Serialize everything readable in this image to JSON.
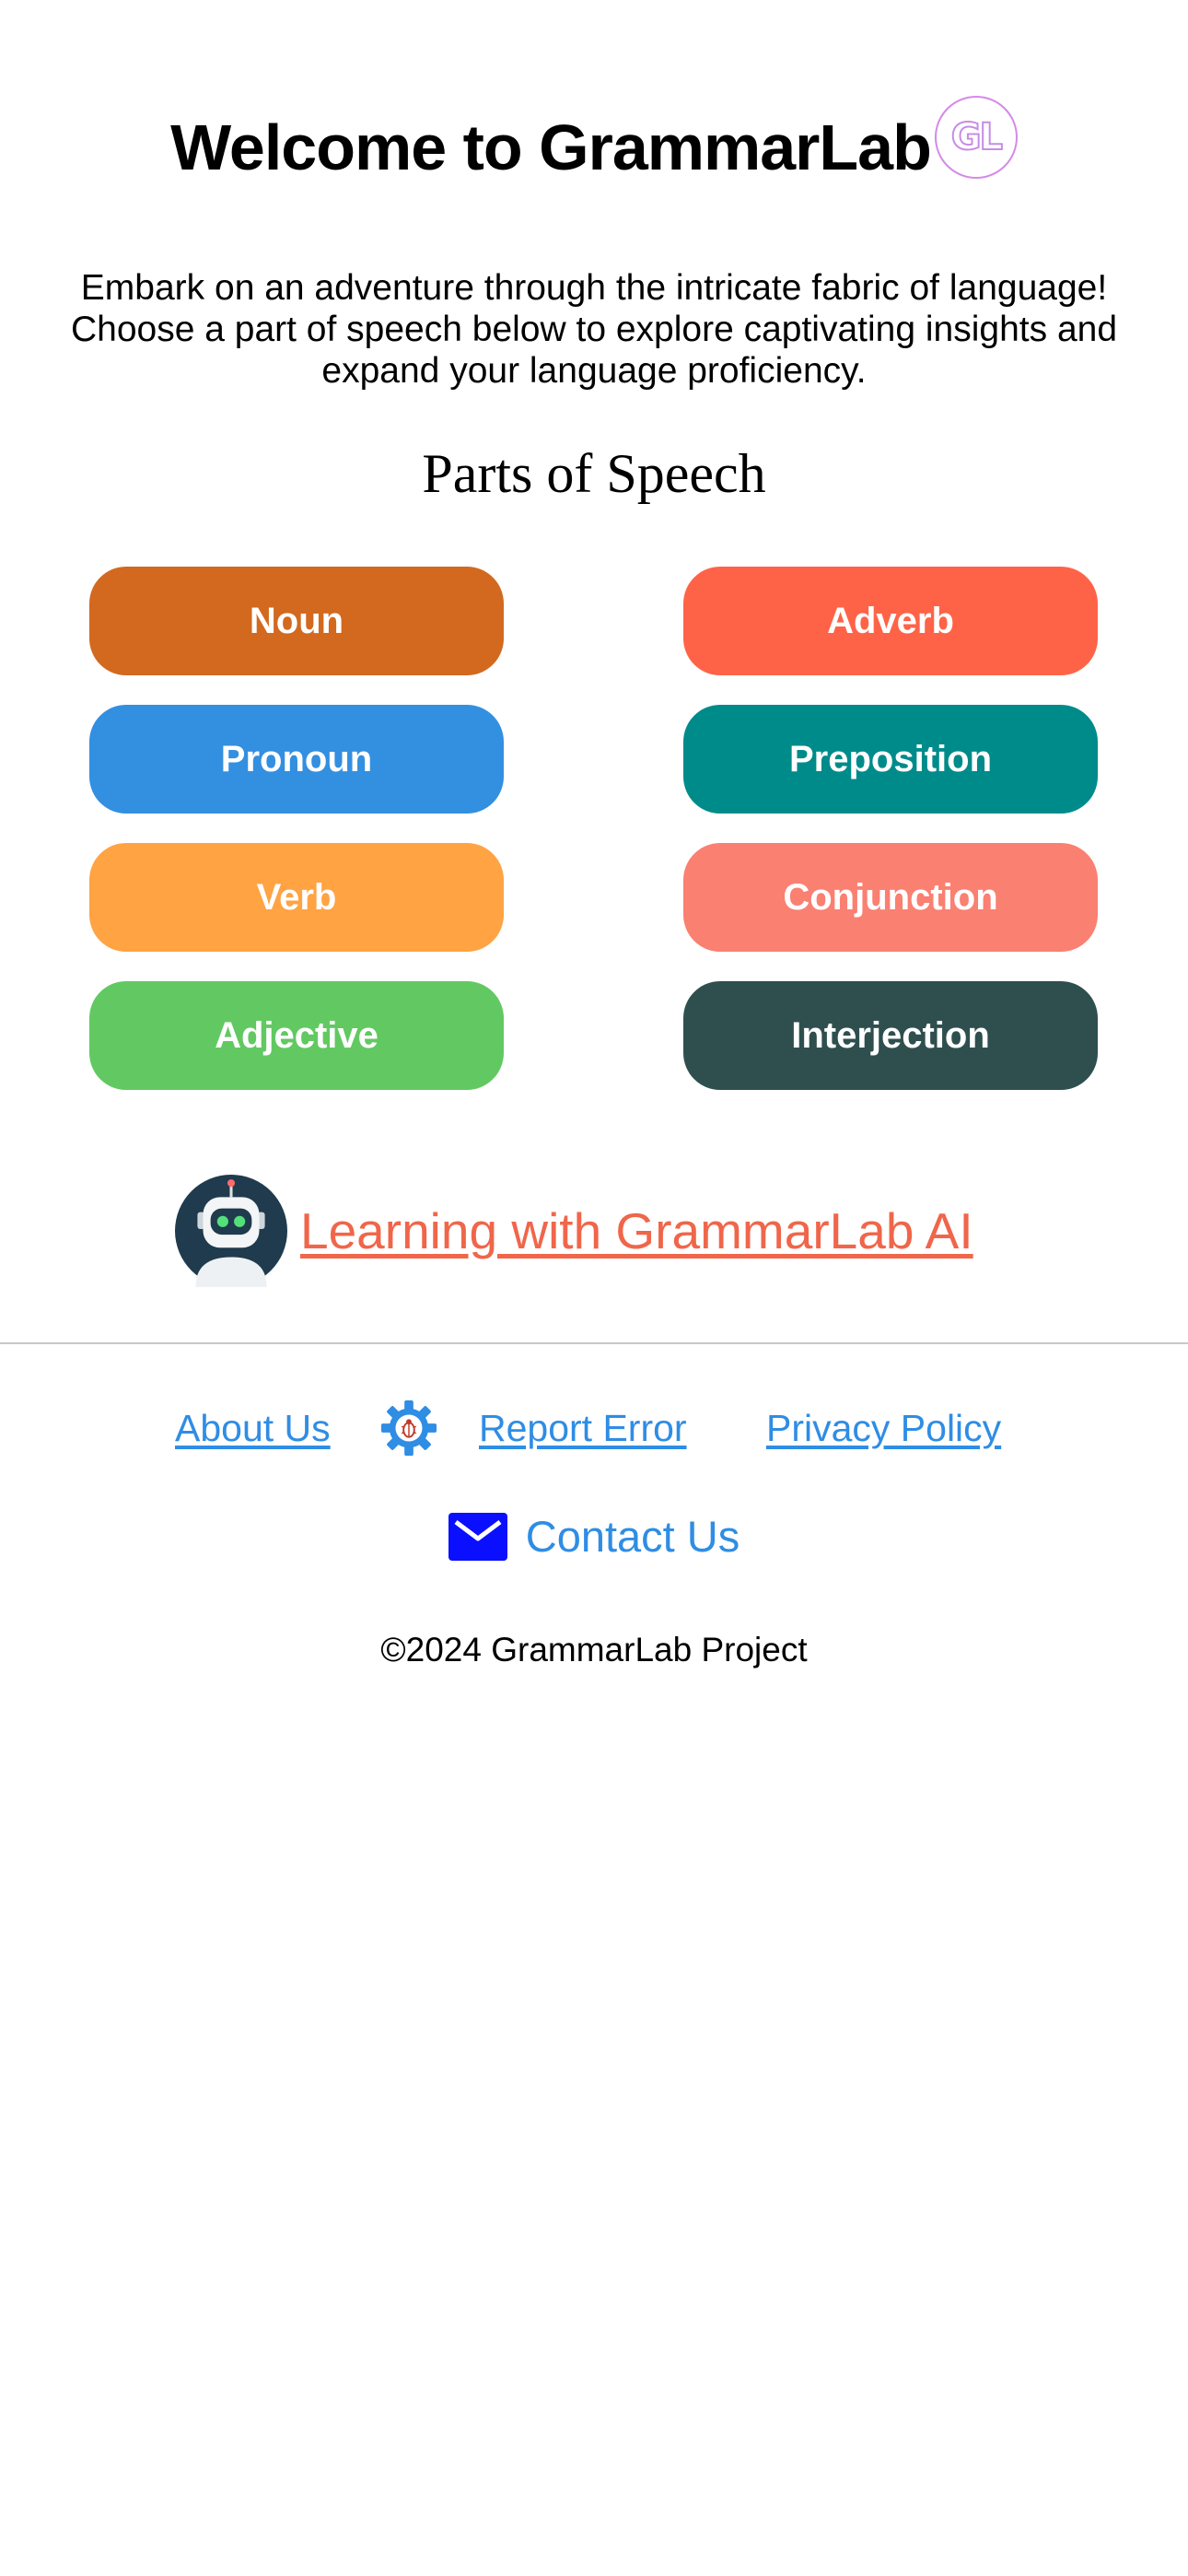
{
  "header": {
    "title": "Welcome to GrammarLab",
    "badge_text": "GL"
  },
  "intro": {
    "text": "Embark on an adventure through the intricate fabric of language! Choose a part of speech below to explore captivating insights and expand your language proficiency."
  },
  "section": {
    "title": "Parts of Speech"
  },
  "parts_of_speech": [
    {
      "label": "Noun",
      "color": "#d2691e"
    },
    {
      "label": "Adverb",
      "color": "#ff6347"
    },
    {
      "label": "Pronoun",
      "color": "#338fe0"
    },
    {
      "label": "Preposition",
      "color": "#008b8b"
    },
    {
      "label": "Verb",
      "color": "#ffa343"
    },
    {
      "label": "Conjunction",
      "color": "#fa8072"
    },
    {
      "label": "Adjective",
      "color": "#62c962"
    },
    {
      "label": "Interjection",
      "color": "#2f4f4f"
    }
  ],
  "ai": {
    "icon": "robot-icon",
    "link_text": "Learning with GrammarLab AI",
    "link_color": "#f0664a"
  },
  "footer": {
    "links": {
      "about": "About Us",
      "report": "Report Error",
      "privacy": "Privacy Policy"
    },
    "report_icon": "bug-gear-icon",
    "contact_icon": "mail-icon",
    "contact": "Contact Us",
    "copyright": "©2024 GrammarLab Project",
    "link_color": "#2f8de4"
  }
}
